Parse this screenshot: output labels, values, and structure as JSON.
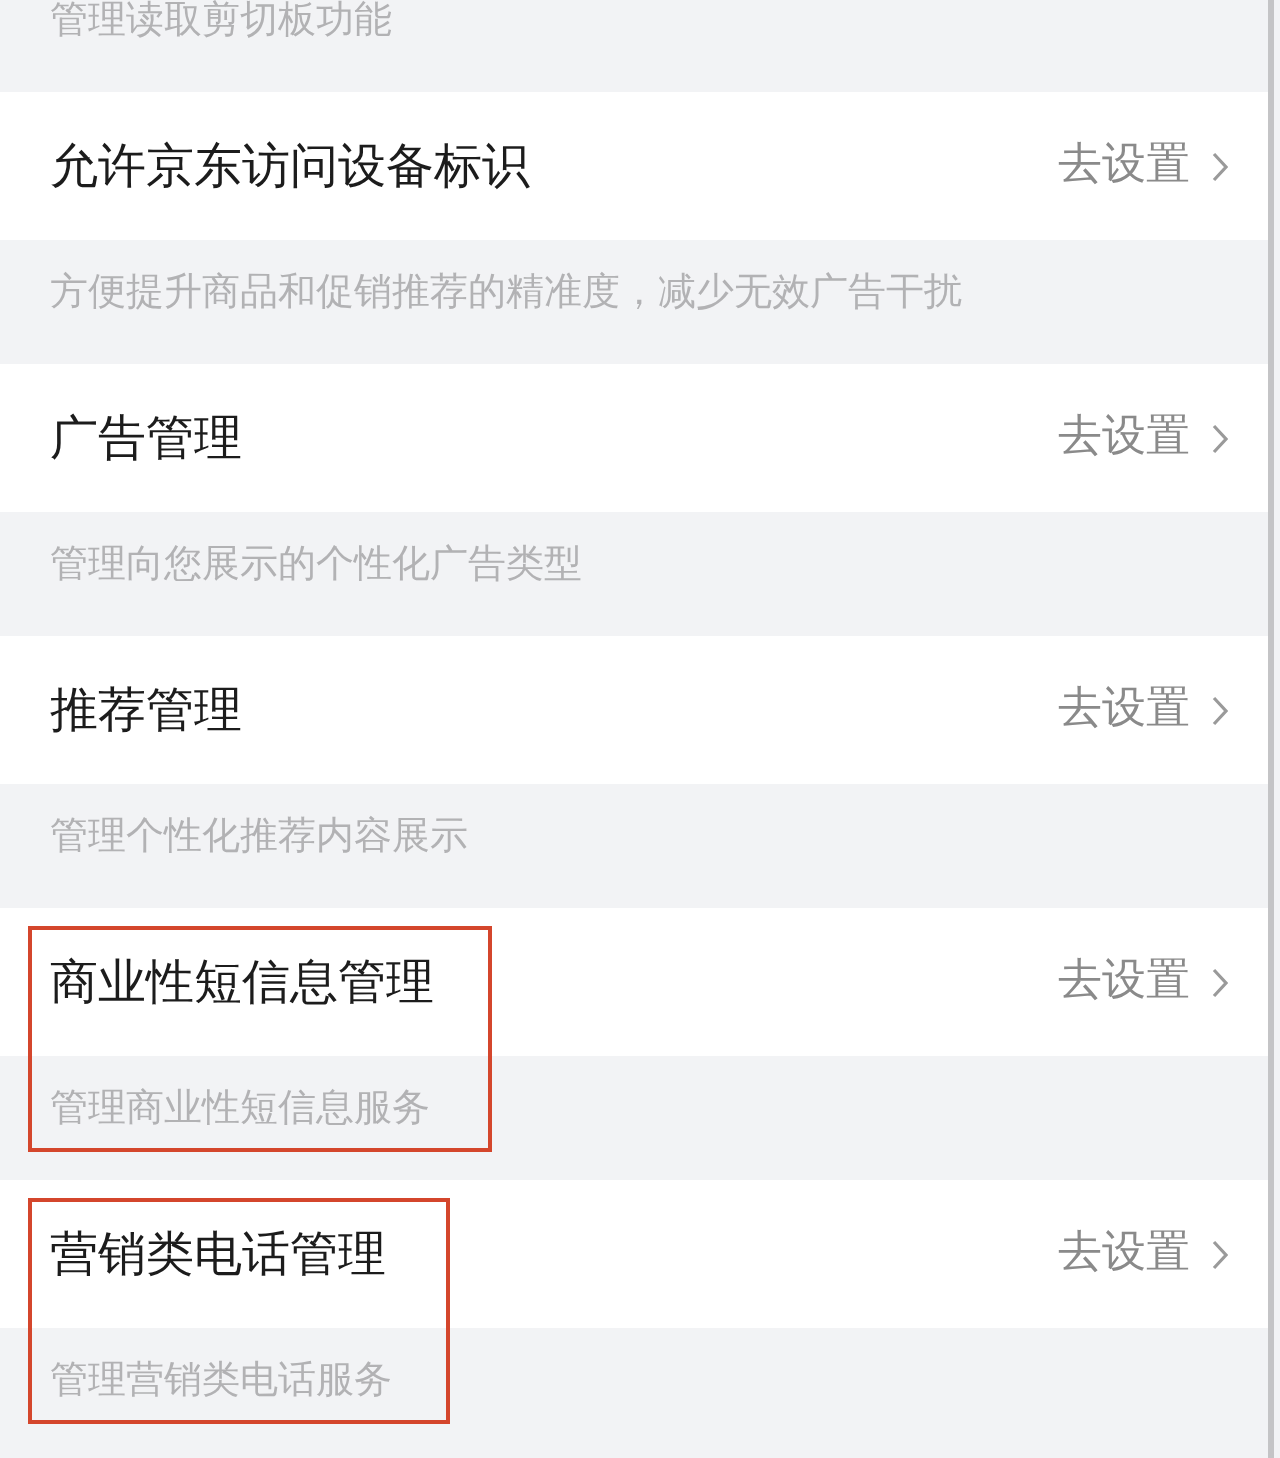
{
  "items": [
    {
      "description": "管理读取剪切板功能",
      "highlighted": false
    },
    {
      "title": "允许京东访问设备标识",
      "action": "去设置",
      "description": "方便提升商品和促销推荐的精准度，减少无效广告干扰",
      "highlighted": false
    },
    {
      "title": "广告管理",
      "action": "去设置",
      "description": "管理向您展示的个性化广告类型",
      "highlighted": false
    },
    {
      "title": "推荐管理",
      "action": "去设置",
      "description": "管理个性化推荐内容展示",
      "highlighted": false
    },
    {
      "title": "商业性短信息管理",
      "action": "去设置",
      "description": "管理商业性短信息服务",
      "highlighted": true
    },
    {
      "title": "营销类电话管理",
      "action": "去设置",
      "description": "管理营销类电话服务",
      "highlighted": true
    }
  ]
}
